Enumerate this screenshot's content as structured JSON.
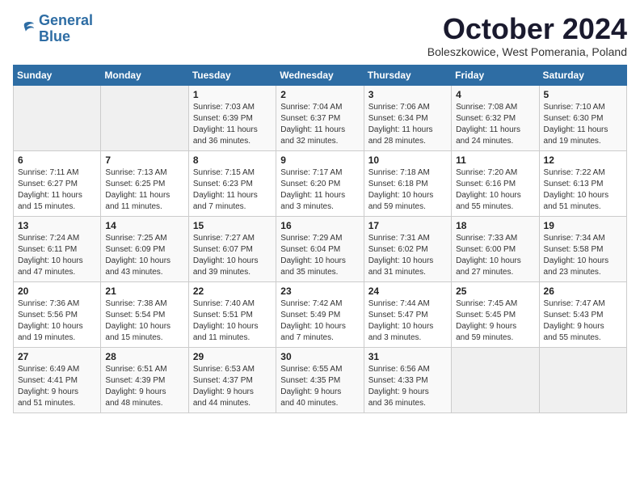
{
  "logo": {
    "line1": "General",
    "line2": "Blue"
  },
  "title": "October 2024",
  "subtitle": "Boleszkowice, West Pomerania, Poland",
  "header_days": [
    "Sunday",
    "Monday",
    "Tuesday",
    "Wednesday",
    "Thursday",
    "Friday",
    "Saturday"
  ],
  "weeks": [
    [
      {
        "day": "",
        "content": ""
      },
      {
        "day": "",
        "content": ""
      },
      {
        "day": "1",
        "content": "Sunrise: 7:03 AM\nSunset: 6:39 PM\nDaylight: 11 hours\nand 36 minutes."
      },
      {
        "day": "2",
        "content": "Sunrise: 7:04 AM\nSunset: 6:37 PM\nDaylight: 11 hours\nand 32 minutes."
      },
      {
        "day": "3",
        "content": "Sunrise: 7:06 AM\nSunset: 6:34 PM\nDaylight: 11 hours\nand 28 minutes."
      },
      {
        "day": "4",
        "content": "Sunrise: 7:08 AM\nSunset: 6:32 PM\nDaylight: 11 hours\nand 24 minutes."
      },
      {
        "day": "5",
        "content": "Sunrise: 7:10 AM\nSunset: 6:30 PM\nDaylight: 11 hours\nand 19 minutes."
      }
    ],
    [
      {
        "day": "6",
        "content": "Sunrise: 7:11 AM\nSunset: 6:27 PM\nDaylight: 11 hours\nand 15 minutes."
      },
      {
        "day": "7",
        "content": "Sunrise: 7:13 AM\nSunset: 6:25 PM\nDaylight: 11 hours\nand 11 minutes."
      },
      {
        "day": "8",
        "content": "Sunrise: 7:15 AM\nSunset: 6:23 PM\nDaylight: 11 hours\nand 7 minutes."
      },
      {
        "day": "9",
        "content": "Sunrise: 7:17 AM\nSunset: 6:20 PM\nDaylight: 11 hours\nand 3 minutes."
      },
      {
        "day": "10",
        "content": "Sunrise: 7:18 AM\nSunset: 6:18 PM\nDaylight: 10 hours\nand 59 minutes."
      },
      {
        "day": "11",
        "content": "Sunrise: 7:20 AM\nSunset: 6:16 PM\nDaylight: 10 hours\nand 55 minutes."
      },
      {
        "day": "12",
        "content": "Sunrise: 7:22 AM\nSunset: 6:13 PM\nDaylight: 10 hours\nand 51 minutes."
      }
    ],
    [
      {
        "day": "13",
        "content": "Sunrise: 7:24 AM\nSunset: 6:11 PM\nDaylight: 10 hours\nand 47 minutes."
      },
      {
        "day": "14",
        "content": "Sunrise: 7:25 AM\nSunset: 6:09 PM\nDaylight: 10 hours\nand 43 minutes."
      },
      {
        "day": "15",
        "content": "Sunrise: 7:27 AM\nSunset: 6:07 PM\nDaylight: 10 hours\nand 39 minutes."
      },
      {
        "day": "16",
        "content": "Sunrise: 7:29 AM\nSunset: 6:04 PM\nDaylight: 10 hours\nand 35 minutes."
      },
      {
        "day": "17",
        "content": "Sunrise: 7:31 AM\nSunset: 6:02 PM\nDaylight: 10 hours\nand 31 minutes."
      },
      {
        "day": "18",
        "content": "Sunrise: 7:33 AM\nSunset: 6:00 PM\nDaylight: 10 hours\nand 27 minutes."
      },
      {
        "day": "19",
        "content": "Sunrise: 7:34 AM\nSunset: 5:58 PM\nDaylight: 10 hours\nand 23 minutes."
      }
    ],
    [
      {
        "day": "20",
        "content": "Sunrise: 7:36 AM\nSunset: 5:56 PM\nDaylight: 10 hours\nand 19 minutes."
      },
      {
        "day": "21",
        "content": "Sunrise: 7:38 AM\nSunset: 5:54 PM\nDaylight: 10 hours\nand 15 minutes."
      },
      {
        "day": "22",
        "content": "Sunrise: 7:40 AM\nSunset: 5:51 PM\nDaylight: 10 hours\nand 11 minutes."
      },
      {
        "day": "23",
        "content": "Sunrise: 7:42 AM\nSunset: 5:49 PM\nDaylight: 10 hours\nand 7 minutes."
      },
      {
        "day": "24",
        "content": "Sunrise: 7:44 AM\nSunset: 5:47 PM\nDaylight: 10 hours\nand 3 minutes."
      },
      {
        "day": "25",
        "content": "Sunrise: 7:45 AM\nSunset: 5:45 PM\nDaylight: 9 hours\nand 59 minutes."
      },
      {
        "day": "26",
        "content": "Sunrise: 7:47 AM\nSunset: 5:43 PM\nDaylight: 9 hours\nand 55 minutes."
      }
    ],
    [
      {
        "day": "27",
        "content": "Sunrise: 6:49 AM\nSunset: 4:41 PM\nDaylight: 9 hours\nand 51 minutes."
      },
      {
        "day": "28",
        "content": "Sunrise: 6:51 AM\nSunset: 4:39 PM\nDaylight: 9 hours\nand 48 minutes."
      },
      {
        "day": "29",
        "content": "Sunrise: 6:53 AM\nSunset: 4:37 PM\nDaylight: 9 hours\nand 44 minutes."
      },
      {
        "day": "30",
        "content": "Sunrise: 6:55 AM\nSunset: 4:35 PM\nDaylight: 9 hours\nand 40 minutes."
      },
      {
        "day": "31",
        "content": "Sunrise: 6:56 AM\nSunset: 4:33 PM\nDaylight: 9 hours\nand 36 minutes."
      },
      {
        "day": "",
        "content": ""
      },
      {
        "day": "",
        "content": ""
      }
    ]
  ]
}
